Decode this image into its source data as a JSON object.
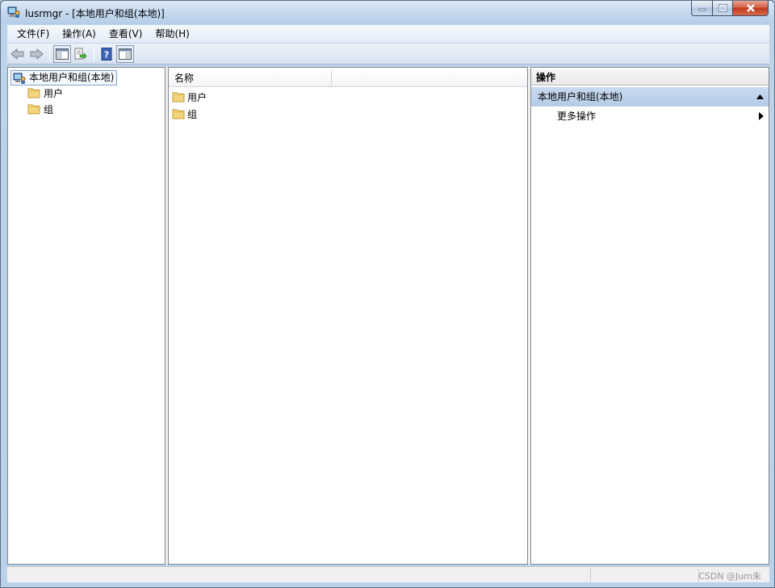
{
  "window": {
    "title": "lusrmgr - [本地用户和组(本地)]"
  },
  "menu": {
    "items": [
      {
        "label": "文件(F)"
      },
      {
        "label": "操作(A)"
      },
      {
        "label": "查看(V)"
      },
      {
        "label": "帮助(H)"
      }
    ]
  },
  "toolbar": {
    "buttons": [
      "back-arrow-icon",
      "forward-arrow-icon",
      "show-hide-tree-icon",
      "export-list-icon",
      "help-icon",
      "show-hide-action-pane-icon"
    ]
  },
  "tree": {
    "root": "本地用户和组(本地)",
    "children": [
      {
        "label": "用户"
      },
      {
        "label": "组"
      }
    ]
  },
  "list": {
    "column_name": "名称",
    "rows": [
      {
        "label": "用户"
      },
      {
        "label": "组"
      }
    ]
  },
  "actions": {
    "header": "操作",
    "group_title": "本地用户和组(本地)",
    "more_actions": "更多操作"
  },
  "statusbar": {
    "watermark": "CSDN @Jum朱"
  },
  "colors": {
    "accent_selected": "#b3cbe6",
    "folder": "#f2d57e"
  }
}
